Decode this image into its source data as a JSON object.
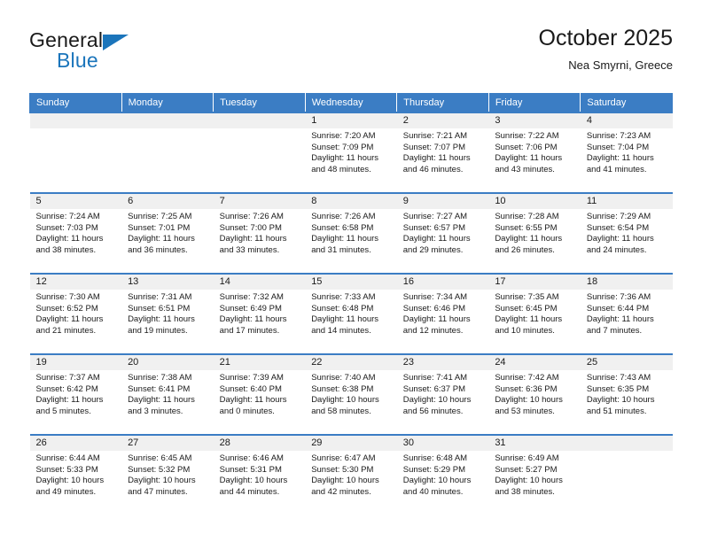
{
  "brand": {
    "name_top": "General",
    "name_bottom": "Blue",
    "accent_color": "#1b75bb",
    "triangle_icon": "brand-triangle-icon"
  },
  "header": {
    "title": "October 2025",
    "subtitle": "Nea Smyrni, Greece"
  },
  "theme": {
    "header_row_bg": "#3b7dc4",
    "header_row_text": "#ffffff",
    "daynum_band_bg": "#f0f0f0",
    "cell_bg": "#ffffff",
    "row_divider": "#3b7dc4"
  },
  "calendar": {
    "weekday_headers": [
      "Sunday",
      "Monday",
      "Tuesday",
      "Wednesday",
      "Thursday",
      "Friday",
      "Saturday"
    ],
    "weeks": [
      [
        {
          "day": "",
          "lines": []
        },
        {
          "day": "",
          "lines": []
        },
        {
          "day": "",
          "lines": []
        },
        {
          "day": "1",
          "lines": [
            "Sunrise: 7:20 AM",
            "Sunset: 7:09 PM",
            "Daylight: 11 hours",
            "and 48 minutes."
          ]
        },
        {
          "day": "2",
          "lines": [
            "Sunrise: 7:21 AM",
            "Sunset: 7:07 PM",
            "Daylight: 11 hours",
            "and 46 minutes."
          ]
        },
        {
          "day": "3",
          "lines": [
            "Sunrise: 7:22 AM",
            "Sunset: 7:06 PM",
            "Daylight: 11 hours",
            "and 43 minutes."
          ]
        },
        {
          "day": "4",
          "lines": [
            "Sunrise: 7:23 AM",
            "Sunset: 7:04 PM",
            "Daylight: 11 hours",
            "and 41 minutes."
          ]
        }
      ],
      [
        {
          "day": "5",
          "lines": [
            "Sunrise: 7:24 AM",
            "Sunset: 7:03 PM",
            "Daylight: 11 hours",
            "and 38 minutes."
          ]
        },
        {
          "day": "6",
          "lines": [
            "Sunrise: 7:25 AM",
            "Sunset: 7:01 PM",
            "Daylight: 11 hours",
            "and 36 minutes."
          ]
        },
        {
          "day": "7",
          "lines": [
            "Sunrise: 7:26 AM",
            "Sunset: 7:00 PM",
            "Daylight: 11 hours",
            "and 33 minutes."
          ]
        },
        {
          "day": "8",
          "lines": [
            "Sunrise: 7:26 AM",
            "Sunset: 6:58 PM",
            "Daylight: 11 hours",
            "and 31 minutes."
          ]
        },
        {
          "day": "9",
          "lines": [
            "Sunrise: 7:27 AM",
            "Sunset: 6:57 PM",
            "Daylight: 11 hours",
            "and 29 minutes."
          ]
        },
        {
          "day": "10",
          "lines": [
            "Sunrise: 7:28 AM",
            "Sunset: 6:55 PM",
            "Daylight: 11 hours",
            "and 26 minutes."
          ]
        },
        {
          "day": "11",
          "lines": [
            "Sunrise: 7:29 AM",
            "Sunset: 6:54 PM",
            "Daylight: 11 hours",
            "and 24 minutes."
          ]
        }
      ],
      [
        {
          "day": "12",
          "lines": [
            "Sunrise: 7:30 AM",
            "Sunset: 6:52 PM",
            "Daylight: 11 hours",
            "and 21 minutes."
          ]
        },
        {
          "day": "13",
          "lines": [
            "Sunrise: 7:31 AM",
            "Sunset: 6:51 PM",
            "Daylight: 11 hours",
            "and 19 minutes."
          ]
        },
        {
          "day": "14",
          "lines": [
            "Sunrise: 7:32 AM",
            "Sunset: 6:49 PM",
            "Daylight: 11 hours",
            "and 17 minutes."
          ]
        },
        {
          "day": "15",
          "lines": [
            "Sunrise: 7:33 AM",
            "Sunset: 6:48 PM",
            "Daylight: 11 hours",
            "and 14 minutes."
          ]
        },
        {
          "day": "16",
          "lines": [
            "Sunrise: 7:34 AM",
            "Sunset: 6:46 PM",
            "Daylight: 11 hours",
            "and 12 minutes."
          ]
        },
        {
          "day": "17",
          "lines": [
            "Sunrise: 7:35 AM",
            "Sunset: 6:45 PM",
            "Daylight: 11 hours",
            "and 10 minutes."
          ]
        },
        {
          "day": "18",
          "lines": [
            "Sunrise: 7:36 AM",
            "Sunset: 6:44 PM",
            "Daylight: 11 hours",
            "and 7 minutes."
          ]
        }
      ],
      [
        {
          "day": "19",
          "lines": [
            "Sunrise: 7:37 AM",
            "Sunset: 6:42 PM",
            "Daylight: 11 hours",
            "and 5 minutes."
          ]
        },
        {
          "day": "20",
          "lines": [
            "Sunrise: 7:38 AM",
            "Sunset: 6:41 PM",
            "Daylight: 11 hours",
            "and 3 minutes."
          ]
        },
        {
          "day": "21",
          "lines": [
            "Sunrise: 7:39 AM",
            "Sunset: 6:40 PM",
            "Daylight: 11 hours",
            "and 0 minutes."
          ]
        },
        {
          "day": "22",
          "lines": [
            "Sunrise: 7:40 AM",
            "Sunset: 6:38 PM",
            "Daylight: 10 hours",
            "and 58 minutes."
          ]
        },
        {
          "day": "23",
          "lines": [
            "Sunrise: 7:41 AM",
            "Sunset: 6:37 PM",
            "Daylight: 10 hours",
            "and 56 minutes."
          ]
        },
        {
          "day": "24",
          "lines": [
            "Sunrise: 7:42 AM",
            "Sunset: 6:36 PM",
            "Daylight: 10 hours",
            "and 53 minutes."
          ]
        },
        {
          "day": "25",
          "lines": [
            "Sunrise: 7:43 AM",
            "Sunset: 6:35 PM",
            "Daylight: 10 hours",
            "and 51 minutes."
          ]
        }
      ],
      [
        {
          "day": "26",
          "lines": [
            "Sunrise: 6:44 AM",
            "Sunset: 5:33 PM",
            "Daylight: 10 hours",
            "and 49 minutes."
          ]
        },
        {
          "day": "27",
          "lines": [
            "Sunrise: 6:45 AM",
            "Sunset: 5:32 PM",
            "Daylight: 10 hours",
            "and 47 minutes."
          ]
        },
        {
          "day": "28",
          "lines": [
            "Sunrise: 6:46 AM",
            "Sunset: 5:31 PM",
            "Daylight: 10 hours",
            "and 44 minutes."
          ]
        },
        {
          "day": "29",
          "lines": [
            "Sunrise: 6:47 AM",
            "Sunset: 5:30 PM",
            "Daylight: 10 hours",
            "and 42 minutes."
          ]
        },
        {
          "day": "30",
          "lines": [
            "Sunrise: 6:48 AM",
            "Sunset: 5:29 PM",
            "Daylight: 10 hours",
            "and 40 minutes."
          ]
        },
        {
          "day": "31",
          "lines": [
            "Sunrise: 6:49 AM",
            "Sunset: 5:27 PM",
            "Daylight: 10 hours",
            "and 38 minutes."
          ]
        },
        {
          "day": "",
          "lines": []
        }
      ]
    ]
  }
}
